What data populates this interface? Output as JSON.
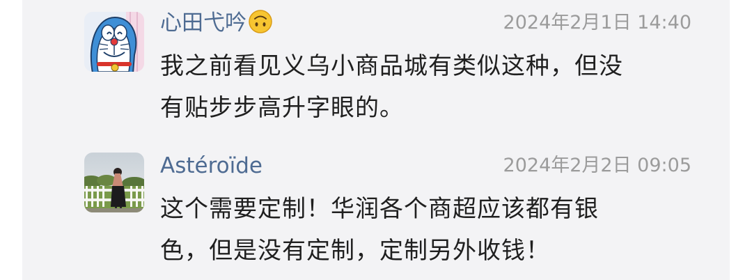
{
  "comments": [
    {
      "username": "心田弋吟",
      "username_emoji": "upside-down-face-emoji",
      "timestamp": "2024年2月1日 14:40",
      "text_line_1": "我之前看见义乌小商品城有类似这种，但没",
      "text_line_2": "有贴步步高升字眼的。",
      "avatar": "doraemon-cartoon-avatar"
    },
    {
      "username": "Astéroïde",
      "timestamp": "2024年2月2日 09:05",
      "text_line_1": "这个需要定制！华润各个商超应该都有银",
      "text_line_2": "色，但是没有定制，定制另外收钱！",
      "avatar": "outdoor-photo-avatar"
    }
  ],
  "colors": {
    "background": "#f3f3f5",
    "username": "#4e6b92",
    "timestamp": "#9b9b9b",
    "body_text": "#1f1f1f"
  }
}
